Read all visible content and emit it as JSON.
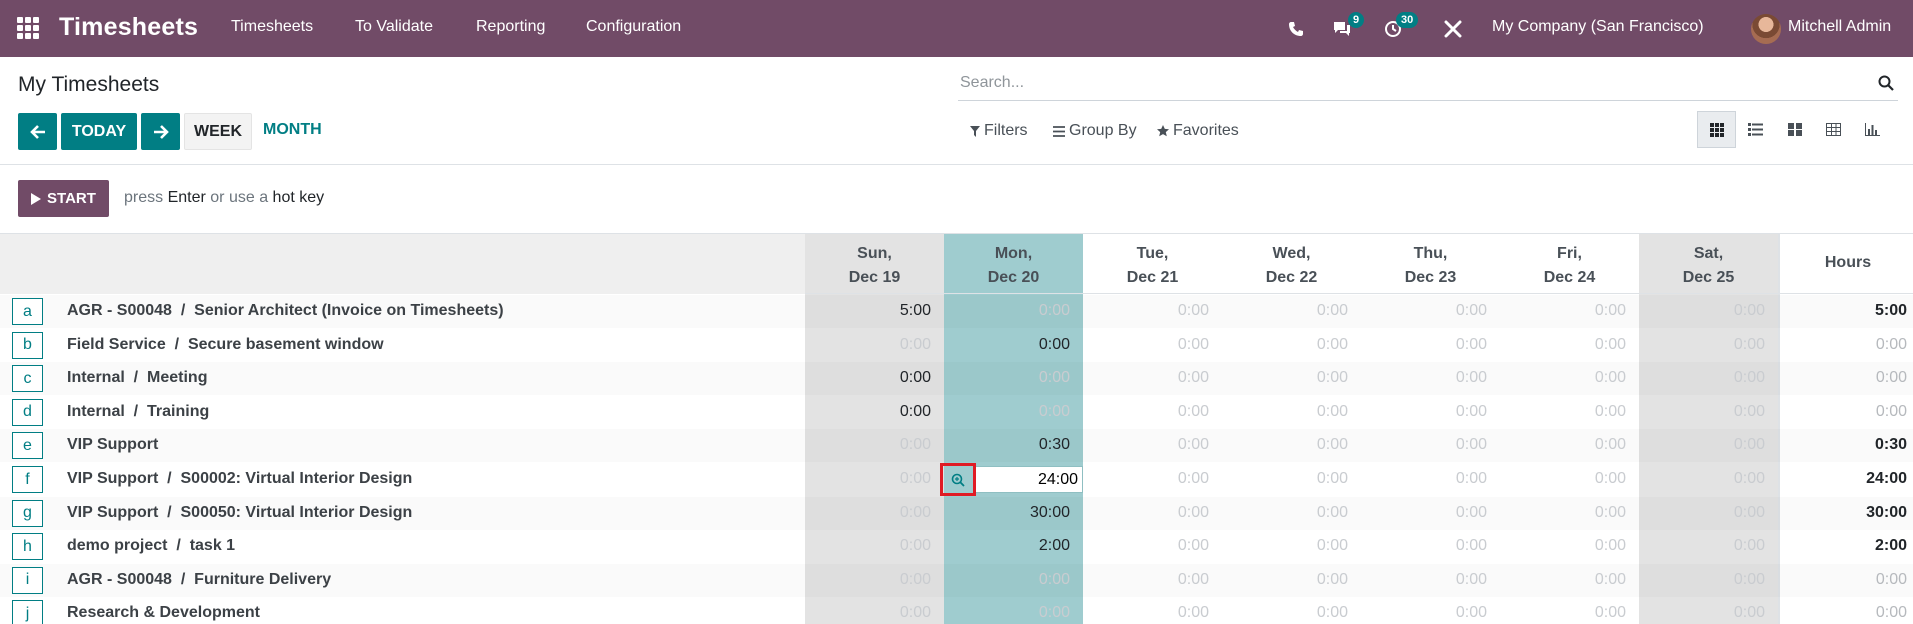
{
  "navbar": {
    "app_name": "Timesheets",
    "menu": [
      "Timesheets",
      "To Validate",
      "Reporting",
      "Configuration"
    ],
    "messages_count": "9",
    "activities_count": "30",
    "company": "My Company (San Francisco)",
    "user": "Mitchell Admin",
    "icons": [
      "apps-icon",
      "phone-icon",
      "chat-icon",
      "clock-icon",
      "tools-icon",
      "avatar"
    ]
  },
  "control_panel": {
    "title": "My Timesheets",
    "search_placeholder": "Search...",
    "today_label": "TODAY",
    "week_label": "WEEK",
    "month_label": "MONTH",
    "filters_label": "Filters",
    "group_by_label": "Group By",
    "favorites_label": "Favorites",
    "views": [
      "grid",
      "list",
      "kanban",
      "pivot",
      "graph"
    ],
    "active_view": "grid"
  },
  "timer": {
    "start_label": "START",
    "hint_prefix": "press",
    "hint_enter": "Enter",
    "hint_mid": "or use a",
    "hint_hotkey": "hot key"
  },
  "grid": {
    "days": [
      {
        "dow": "Sun,",
        "date": "Dec 19"
      },
      {
        "dow": "Mon,",
        "date": "Dec 20"
      },
      {
        "dow": "Tue,",
        "date": "Dec 21"
      },
      {
        "dow": "Wed,",
        "date": "Dec 22"
      },
      {
        "dow": "Thu,",
        "date": "Dec 23"
      },
      {
        "dow": "Fri,",
        "date": "Dec 24"
      },
      {
        "dow": "Sat,",
        "date": "Dec 25"
      }
    ],
    "hours_label": "Hours",
    "rows": [
      {
        "key": "a",
        "label": "AGR - S00048  /  Senior Architect (Invoice on Timesheets)",
        "cells": [
          "5:00",
          "0:00",
          "0:00",
          "0:00",
          "0:00",
          "0:00",
          "0:00"
        ],
        "total": "5:00"
      },
      {
        "key": "b",
        "label": "Field Service  /  Secure basement window",
        "cells": [
          "0:00",
          "0:00",
          "0:00",
          "0:00",
          "0:00",
          "0:00",
          "0:00"
        ],
        "total": "0:00"
      },
      {
        "key": "c",
        "label": "Internal  /  Meeting",
        "cells": [
          "0:00",
          "0:00",
          "0:00",
          "0:00",
          "0:00",
          "0:00",
          "0:00"
        ],
        "total": "0:00"
      },
      {
        "key": "d",
        "label": "Internal  /  Training",
        "cells": [
          "0:00",
          "0:00",
          "0:00",
          "0:00",
          "0:00",
          "0:00",
          "0:00"
        ],
        "total": "0:00"
      },
      {
        "key": "e",
        "label": "VIP Support",
        "cells": [
          "0:00",
          "0:30",
          "0:00",
          "0:00",
          "0:00",
          "0:00",
          "0:00"
        ],
        "total": "0:30"
      },
      {
        "key": "f",
        "label": "VIP Support  /  S00002: Virtual Interior Design",
        "cells": [
          "0:00",
          "24:00",
          "0:00",
          "0:00",
          "0:00",
          "0:00",
          "0:00"
        ],
        "total": "24:00"
      },
      {
        "key": "g",
        "label": "VIP Support  /  S00050: Virtual Interior Design",
        "cells": [
          "0:00",
          "30:00",
          "0:00",
          "0:00",
          "0:00",
          "0:00",
          "0:00"
        ],
        "total": "30:00"
      },
      {
        "key": "h",
        "label": "demo project  /  task 1",
        "cells": [
          "0:00",
          "2:00",
          "0:00",
          "0:00",
          "0:00",
          "0:00",
          "0:00"
        ],
        "total": "2:00"
      },
      {
        "key": "i",
        "label": "AGR - S00048  /  Furniture Delivery",
        "cells": [
          "0:00",
          "0:00",
          "0:00",
          "0:00",
          "0:00",
          "0:00",
          "0:00"
        ],
        "total": "0:00"
      },
      {
        "key": "j",
        "label": "Research & Development",
        "cells": [
          "0:00",
          "0:00",
          "0:00",
          "0:00",
          "0:00",
          "0:00",
          "0:00"
        ],
        "total": "0:00"
      }
    ],
    "highlighted_values": {
      "sun_c": "0:00",
      "sun_d": "0:00",
      "mon_b": "0:00",
      "mon_e": "0:30",
      "mon_g": "30:00",
      "mon_h": "2:00"
    }
  },
  "colors": {
    "navbar": "#714b67",
    "accent": "#017e84",
    "today_column": "#9fcccf",
    "weekend_column": "#e3e3e3",
    "zoom_highlight": "#e01b24"
  }
}
